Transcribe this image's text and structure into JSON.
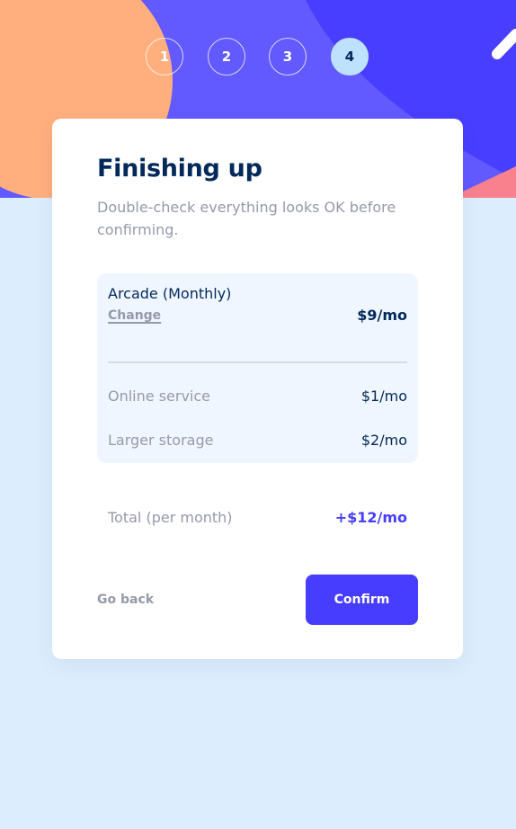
{
  "colors": {
    "marine_blue": "#02295a",
    "purplish_blue": "#473dff",
    "pastel_blue": "#adbeff",
    "light_blue": "#bee2fd",
    "cool_gray": "#9699ab",
    "light_gray": "#d6d9e6",
    "magnolia": "#f0f6ff",
    "alabaster": "#fafbff",
    "page_background": "#dcedfd",
    "header_orange": "#ffaf7e",
    "header_pink": "#f9818e"
  },
  "steps": [
    {
      "number": "1",
      "active": false
    },
    {
      "number": "2",
      "active": false
    },
    {
      "number": "3",
      "active": false
    },
    {
      "number": "4",
      "active": true
    }
  ],
  "heading": {
    "title": "Finishing up",
    "subtitle": "Double-check everything looks OK before confirming."
  },
  "summary": {
    "plan_name": "Arcade (Monthly)",
    "change_label": "Change",
    "plan_price": "$9/mo",
    "addons": [
      {
        "name": "Online service",
        "price": "$1/mo"
      },
      {
        "name": "Larger storage",
        "price": "$2/mo"
      }
    ]
  },
  "total": {
    "label": "Total (per month)",
    "value": "+$12/mo"
  },
  "actions": {
    "go_back_label": "Go back",
    "confirm_label": "Confirm"
  }
}
